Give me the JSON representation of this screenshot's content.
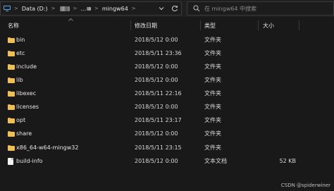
{
  "nav": {
    "segments": [
      "Data (D:)",
      "",
      "...",
      "mingw64"
    ],
    "separator": ">",
    "dropdown_icon": "chevron-down-icon",
    "refresh_icon": "refresh-icon"
  },
  "search": {
    "placeholder": "在 mingw64 中搜索",
    "value": ""
  },
  "columns": {
    "name": "名称",
    "date": "修改日期",
    "type": "类型",
    "size": "大小"
  },
  "rows": [
    {
      "name": "bin",
      "date": "2018/5/12 0:00",
      "type": "文件夹",
      "size": "",
      "icon": "folder-icon"
    },
    {
      "name": "etc",
      "date": "2018/5/11 23:36",
      "type": "文件夹",
      "size": "",
      "icon": "folder-icon"
    },
    {
      "name": "include",
      "date": "2018/5/12 0:00",
      "type": "文件夹",
      "size": "",
      "icon": "folder-icon"
    },
    {
      "name": "lib",
      "date": "2018/5/12 0:00",
      "type": "文件夹",
      "size": "",
      "icon": "folder-icon"
    },
    {
      "name": "libexec",
      "date": "2018/5/11 22:16",
      "type": "文件夹",
      "size": "",
      "icon": "folder-icon"
    },
    {
      "name": "licenses",
      "date": "2018/5/12 0:00",
      "type": "文件夹",
      "size": "",
      "icon": "folder-icon"
    },
    {
      "name": "opt",
      "date": "2018/5/11 23:17",
      "type": "文件夹",
      "size": "",
      "icon": "folder-icon"
    },
    {
      "name": "share",
      "date": "2018/5/12 0:00",
      "type": "文件夹",
      "size": "",
      "icon": "folder-icon"
    },
    {
      "name": "x86_64-w64-mingw32",
      "date": "2018/5/11 23:15",
      "type": "文件夹",
      "size": "",
      "icon": "folder-icon"
    },
    {
      "name": "build-info",
      "date": "2018/5/12 0:00",
      "type": "文本文档",
      "size": "52 KB",
      "icon": "text-file-icon"
    }
  ],
  "watermark": "CSDN @spiderwiner"
}
